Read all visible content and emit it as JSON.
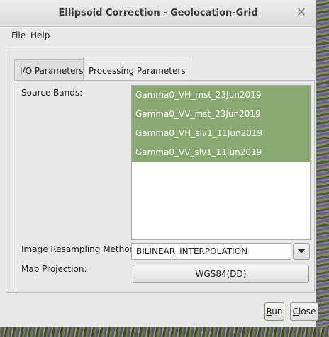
{
  "window": {
    "title": "Ellipsoid Correction - Geolocation-Grid",
    "close_glyph": "✕"
  },
  "menu": {
    "file": "File",
    "help": "Help"
  },
  "tabs": [
    {
      "label": "I/O Parameters"
    },
    {
      "label": "Processing Parameters"
    }
  ],
  "form": {
    "source_bands_label": "Source Bands:",
    "source_bands": [
      "Gamma0_VH_mst_23Jun2019",
      "Gamma0_VV_mst_23Jun2019",
      "Gamma0_VH_slv1_11Jun2019",
      "Gamma0_VV_slv1_11Jun2019"
    ],
    "resampling_label": "Image Resampling Method:",
    "resampling_value": "BILINEAR_INTERPOLATION",
    "projection_label": "Map Projection:",
    "projection_value": "WGS84(DD)"
  },
  "buttons": {
    "run_mnemonic": "R",
    "run_rest": "un",
    "close_mnemonic": "C",
    "close_rest": "lose"
  },
  "colors": {
    "selection": "#8aa872"
  }
}
